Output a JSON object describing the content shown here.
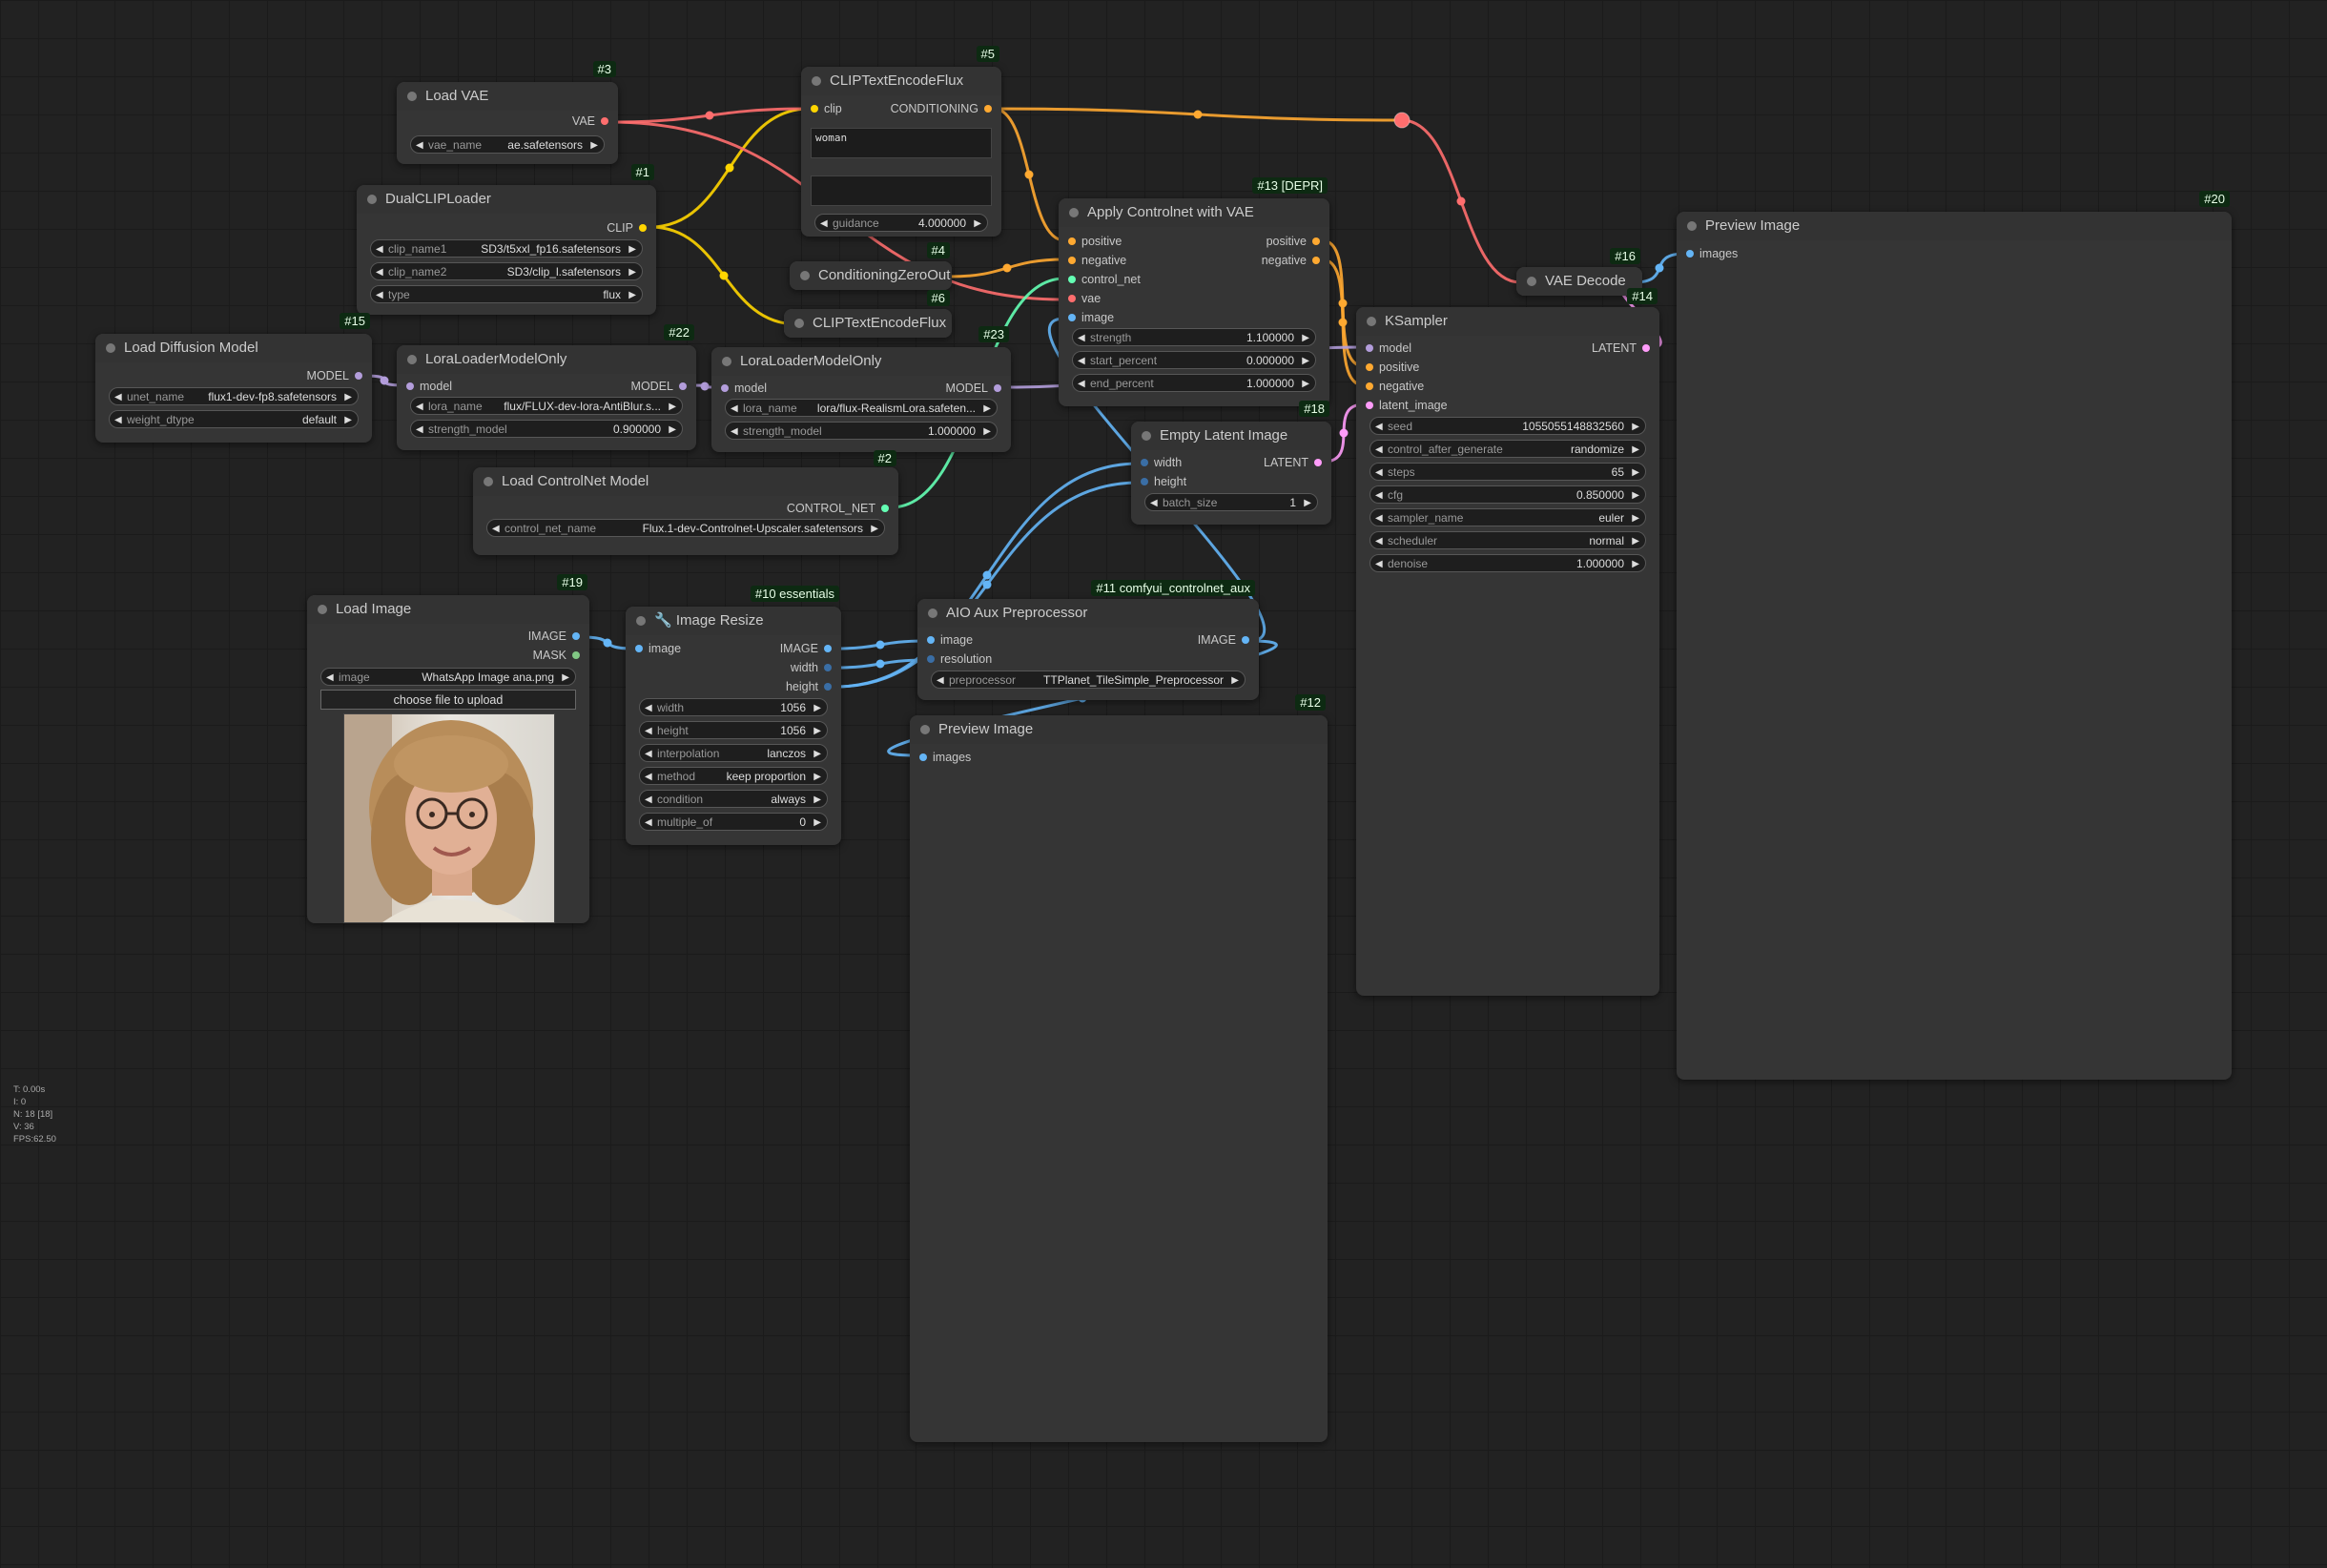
{
  "colors": {
    "clip": "#ffd500",
    "vae": "#ff6e6e",
    "model": "#b39ddb",
    "conditioning": "#ffa931",
    "control_net": "#64ffb4",
    "image": "#64b5f6",
    "latent": "#ff9cf9",
    "mask": "#81c784"
  },
  "nodes": {
    "load_vae": {
      "badge": "#3",
      "title": "Load VAE",
      "out_vae": "VAE",
      "vae_name_label": "vae_name",
      "vae_name": "ae.safetensors"
    },
    "clip_encode_5": {
      "badge": "#5",
      "title": "CLIPTextEncodeFlux",
      "in_clip": "clip",
      "out_conditioning": "CONDITIONING",
      "text1": "woman",
      "text2": "",
      "guidance_label": "guidance",
      "guidance": "4.000000"
    },
    "dual_clip": {
      "badge": "#1",
      "title": "DualCLIPLoader",
      "out_clip": "CLIP",
      "clip_name1_label": "clip_name1",
      "clip_name1": "SD3/t5xxl_fp16.safetensors",
      "clip_name2_label": "clip_name2",
      "clip_name2": "SD3/clip_l.safetensors",
      "type_label": "type",
      "type": "flux"
    },
    "cond_zero": {
      "badge": "#4",
      "title": "ConditioningZeroOut"
    },
    "clip_encode_6": {
      "badge": "#6",
      "title": "CLIPTextEncodeFlux"
    },
    "apply_controlnet": {
      "badge": "#13 [DEPR]",
      "title": "Apply Controlnet with VAE",
      "in_positive": "positive",
      "in_negative": "negative",
      "in_control_net": "control_net",
      "in_vae": "vae",
      "in_image": "image",
      "out_positive": "positive",
      "out_negative": "negative",
      "strength_label": "strength",
      "strength": "1.100000",
      "start_label": "start_percent",
      "start": "0.000000",
      "end_label": "end_percent",
      "end": "1.000000"
    },
    "load_diffusion": {
      "badge": "#15",
      "title": "Load Diffusion Model",
      "out_model": "MODEL",
      "unet_label": "unet_name",
      "unet": "flux1-dev-fp8.safetensors",
      "dtype_label": "weight_dtype",
      "dtype": "default"
    },
    "lora_22": {
      "badge": "#22",
      "title": "LoraLoaderModelOnly",
      "in_model": "model",
      "out_model": "MODEL",
      "lora_label": "lora_name",
      "lora": "flux/FLUX-dev-lora-AntiBlur.s...",
      "strength_label": "strength_model",
      "strength": "0.900000"
    },
    "lora_23": {
      "badge": "#23",
      "title": "LoraLoaderModelOnly",
      "in_model": "model",
      "out_model": "MODEL",
      "lora_label": "lora_name",
      "lora": "lora/flux-RealismLora.safeten...",
      "strength_label": "strength_model",
      "strength": "1.000000"
    },
    "load_controlnet": {
      "badge": "#2",
      "title": "Load ControlNet Model",
      "out": "CONTROL_NET",
      "name_label": "control_net_name",
      "name": "Flux.1-dev-Controlnet-Upscaler.safetensors"
    },
    "empty_latent": {
      "badge": "#18",
      "title": "Empty Latent Image",
      "in_width": "width",
      "in_height": "height",
      "out_latent": "LATENT",
      "batch_label": "batch_size",
      "batch": "1"
    },
    "vae_decode": {
      "badge": "#16",
      "title": "VAE Decode"
    },
    "ksampler": {
      "badge": "#14",
      "title": "KSampler",
      "in_model": "model",
      "in_positive": "positive",
      "in_negative": "negative",
      "in_latent": "latent_image",
      "out_latent": "LATENT",
      "widgets": [
        {
          "label": "seed",
          "value": "1055055148832560"
        },
        {
          "label": "control_after_generate",
          "value": "randomize"
        },
        {
          "label": "steps",
          "value": "65"
        },
        {
          "label": "cfg",
          "value": "0.850000"
        },
        {
          "label": "sampler_name",
          "value": "euler"
        },
        {
          "label": "scheduler",
          "value": "normal"
        },
        {
          "label": "denoise",
          "value": "1.000000"
        }
      ]
    },
    "preview_20": {
      "badge": "#20",
      "title": "Preview Image",
      "in_images": "images"
    },
    "load_image": {
      "badge": "#19",
      "title": "Load Image",
      "out_image": "IMAGE",
      "out_mask": "MASK",
      "image_label": "image",
      "image": "WhatsApp Image ana.png",
      "upload": "choose file to upload"
    },
    "image_resize": {
      "badge": "#10 essentials",
      "title": "🔧 Image Resize",
      "in_image": "image",
      "out_image": "IMAGE",
      "out_width": "width",
      "out_height": "height",
      "widgets": [
        {
          "label": "width",
          "value": "1056"
        },
        {
          "label": "height",
          "value": "1056"
        },
        {
          "label": "interpolation",
          "value": "lanczos"
        },
        {
          "label": "method",
          "value": "keep proportion"
        },
        {
          "label": "condition",
          "value": "always"
        },
        {
          "label": "multiple_of",
          "value": "0"
        }
      ]
    },
    "aio_aux": {
      "badge": "#11 comfyui_controlnet_aux",
      "title": "AIO Aux Preprocessor",
      "in_image": "image",
      "in_resolution": "resolution",
      "out_image": "IMAGE",
      "pre_label": "preprocessor",
      "pre": "TTPlanet_TileSimple_Preprocessor"
    },
    "preview_12": {
      "badge": "#12",
      "title": "Preview Image",
      "in_images": "images"
    }
  },
  "stats": {
    "t": "T: 0.00s",
    "i": "I: 0",
    "n": "N: 18 [18]",
    "v": "V: 36",
    "fps": "FPS:62.50"
  }
}
